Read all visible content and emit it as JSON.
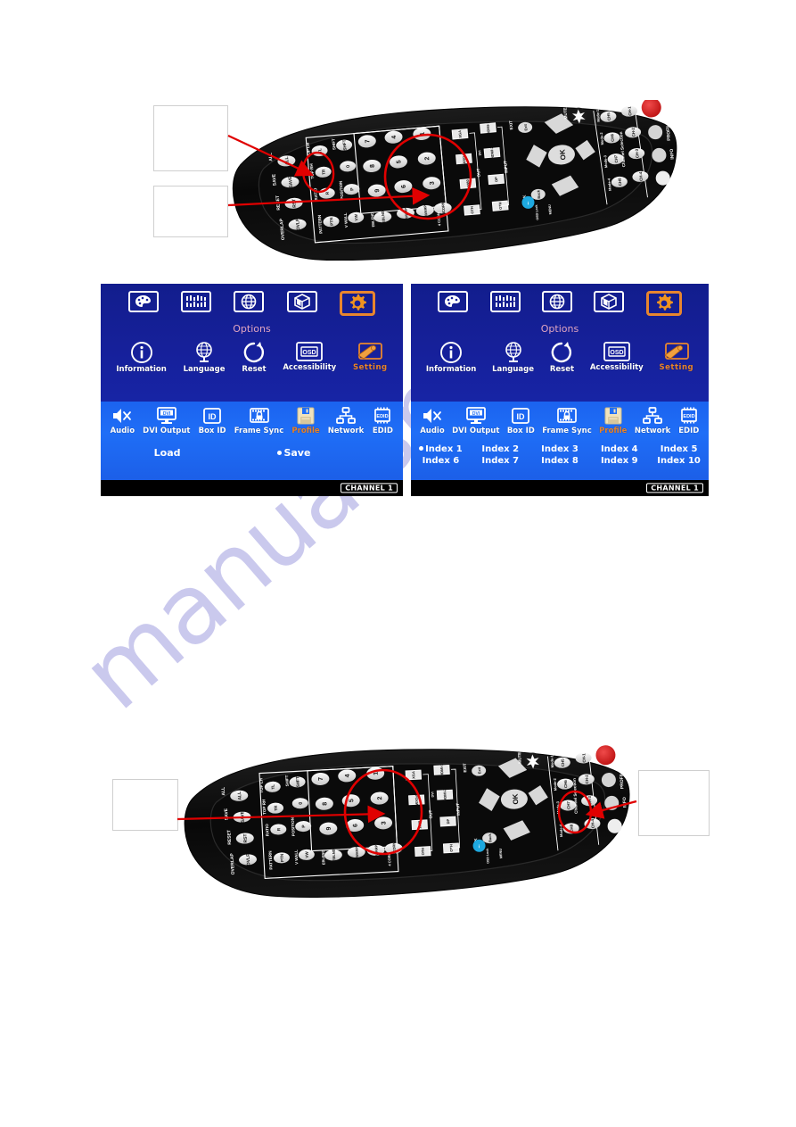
{
  "page": {
    "background": "#ffffff",
    "watermark_text": "manualshive"
  },
  "colors": {
    "osd_dark_blue": "#16209a",
    "osd_light_blue": "#1f6ef7",
    "osd_footer": "#000000",
    "highlight_orange": "#e8862e",
    "options_label": "#e0a5c0",
    "annotation_red": "#e00000",
    "callout_border": "#cfcfcf",
    "remote_body": "#0b0b0b",
    "power_button_red": "#d81a1a"
  },
  "figures": {
    "top_remote": {
      "name": "IR remote control, rotated view",
      "callouts": [
        {
          "id": "callout-top-1",
          "text": ""
        },
        {
          "id": "callout-top-2",
          "text": ""
        }
      ],
      "highlights": [
        {
          "id": "circle-save-reset",
          "target": "SAVE / RESET buttons"
        },
        {
          "id": "circle-number-keypad",
          "target": "numeric keypad 1-9"
        }
      ]
    },
    "bottom_remote": {
      "name": "IR remote control, rotated view",
      "callouts": [
        {
          "id": "callout-bottom-left",
          "text": ""
        },
        {
          "id": "callout-bottom-right",
          "text": ""
        }
      ],
      "highlights": [
        {
          "id": "circle-number-keypad-2",
          "target": "numeric keypad 1-9"
        },
        {
          "id": "circle-profile-button",
          "target": "PROFILE button"
        }
      ]
    }
  },
  "remote": {
    "left_column_labels": [
      "ALL",
      "SAVE",
      "RESET",
      "OVERLAP"
    ],
    "left_keys": [
      "ALL",
      "SAVE",
      "RST",
      "OVLP"
    ],
    "col2_labels": [
      "TOP LH",
      "TOP RH",
      "RATIO",
      "PATTERN"
    ],
    "col2_keys": [
      "TL",
      "TR",
      "R",
      "PTN"
    ],
    "col3_labels": [
      "SHIFT",
      "",
      "POSITION",
      "V WALL"
    ],
    "col3_keys": [
      "SHFT",
      "0",
      "P",
      "VW"
    ],
    "keypad": [
      "7",
      "4",
      "1",
      "8",
      "5",
      "2",
      "9",
      "6",
      "3"
    ],
    "bottom_fn_keys": [
      "EDGE BLEND",
      "WARP",
      "WARP",
      "4 CORNER"
    ],
    "bottom_fn_short": [
      "EBLEND",
      "WARP",
      "WARP",
      "4CORN"
    ],
    "out_labels": [
      "XGA",
      "WXGA",
      "1080",
      "OTH"
    ],
    "input_labels": [
      "HDMI-1",
      "DVI HDMI-2",
      "DP",
      "OTH"
    ],
    "group_labels": [
      "OUT",
      "INPUT"
    ],
    "navigation": {
      "up": "▲",
      "down": "▼",
      "left": "◀",
      "right": "▶",
      "ok": "OK"
    },
    "nav_side_labels": [
      "EXIT",
      "MUTE",
      "BACK",
      "MENU",
      "OSD Lock"
    ],
    "small_round_keys": [
      "Exit",
      "Back"
    ],
    "channel_keys": [
      "CH-1",
      "CH-2",
      "CH-3",
      "CH-4"
    ],
    "channel_group_keys": [
      "CH5",
      "CH6",
      "CH7",
      "CH8"
    ],
    "mode_labels": [
      "Mode-1",
      "Mode-2",
      "Mode-3",
      "Mode-4"
    ],
    "channel_selection_label": "Channel Selection",
    "right_column_labels": [
      "POWER",
      "PROFILE",
      "INFO",
      "CH A/B"
    ]
  },
  "osd_left": {
    "name": "OSD menu - Setting / Profile / Save",
    "top_row": [
      {
        "label": "",
        "icon": "palette-icon",
        "selected": false
      },
      {
        "label": "",
        "icon": "equalizer-icon",
        "selected": false
      },
      {
        "label": "",
        "icon": "globe-icon",
        "selected": false
      },
      {
        "label": "",
        "icon": "cube-icon",
        "selected": false
      },
      {
        "label": "",
        "icon": "gear-icon",
        "selected": true
      }
    ],
    "options_label": "Options",
    "second_row": [
      {
        "label": "Information",
        "icon": "info-icon",
        "selected": false
      },
      {
        "label": "Language",
        "icon": "globe-stand-icon",
        "selected": false
      },
      {
        "label": "Reset",
        "icon": "refresh-icon",
        "selected": false
      },
      {
        "label": "Accessibility",
        "icon": "osd-icon",
        "selected": false
      },
      {
        "label": "Setting",
        "icon": "wrench-screen-icon",
        "selected": true
      }
    ],
    "third_row": [
      {
        "label": "Audio",
        "icon": "speaker-mute-icon",
        "selected": false
      },
      {
        "label": "DVI Output",
        "icon": "dvi-monitor-icon",
        "selected": false
      },
      {
        "label": "Box ID",
        "icon": "id-icon",
        "selected": false
      },
      {
        "label": "Frame Sync",
        "icon": "lock-screen-icon",
        "selected": false
      },
      {
        "label": "Profile",
        "icon": "floppy-disk-icon",
        "selected": true
      },
      {
        "label": "Network",
        "icon": "network-icon",
        "selected": false
      },
      {
        "label": "EDID",
        "icon": "edid-chip-icon",
        "selected": false
      }
    ],
    "action_row": [
      {
        "label": "Load",
        "selected": false
      },
      {
        "label": "Save",
        "selected": true
      }
    ],
    "channel_badge": "CHANNEL 1"
  },
  "osd_right": {
    "name": "OSD menu - Setting / Profile / Index list",
    "top_row": [
      {
        "label": "",
        "icon": "palette-icon",
        "selected": false
      },
      {
        "label": "",
        "icon": "equalizer-icon",
        "selected": false
      },
      {
        "label": "",
        "icon": "globe-icon",
        "selected": false
      },
      {
        "label": "",
        "icon": "cube-icon",
        "selected": false
      },
      {
        "label": "",
        "icon": "gear-icon",
        "selected": true
      }
    ],
    "options_label": "Options",
    "second_row": [
      {
        "label": "Information",
        "icon": "info-icon",
        "selected": false
      },
      {
        "label": "Language",
        "icon": "globe-stand-icon",
        "selected": false
      },
      {
        "label": "Reset",
        "icon": "refresh-icon",
        "selected": false
      },
      {
        "label": "Accessibility",
        "icon": "osd-icon",
        "selected": false
      },
      {
        "label": "Setting",
        "icon": "wrench-screen-icon",
        "selected": true
      }
    ],
    "third_row": [
      {
        "label": "Audio",
        "icon": "speaker-mute-icon",
        "selected": false
      },
      {
        "label": "DVI Output",
        "icon": "dvi-monitor-icon",
        "selected": false
      },
      {
        "label": "Box ID",
        "icon": "id-icon",
        "selected": false
      },
      {
        "label": "Frame Sync",
        "icon": "lock-screen-icon",
        "selected": false
      },
      {
        "label": "Profile",
        "icon": "floppy-disk-icon",
        "selected": true
      },
      {
        "label": "Network",
        "icon": "network-icon",
        "selected": false
      },
      {
        "label": "EDID",
        "icon": "edid-chip-icon",
        "selected": false
      }
    ],
    "index_items": [
      {
        "label": "Index 1",
        "selected": true
      },
      {
        "label": "Index 2",
        "selected": false
      },
      {
        "label": "Index 3",
        "selected": false
      },
      {
        "label": "Index 4",
        "selected": false
      },
      {
        "label": "Index 5",
        "selected": false
      },
      {
        "label": "Index 6",
        "selected": false
      },
      {
        "label": "Index 7",
        "selected": false
      },
      {
        "label": "Index 8",
        "selected": false
      },
      {
        "label": "Index 9",
        "selected": false
      },
      {
        "label": "Index 10",
        "selected": false
      }
    ],
    "channel_badge": "CHANNEL 1"
  }
}
